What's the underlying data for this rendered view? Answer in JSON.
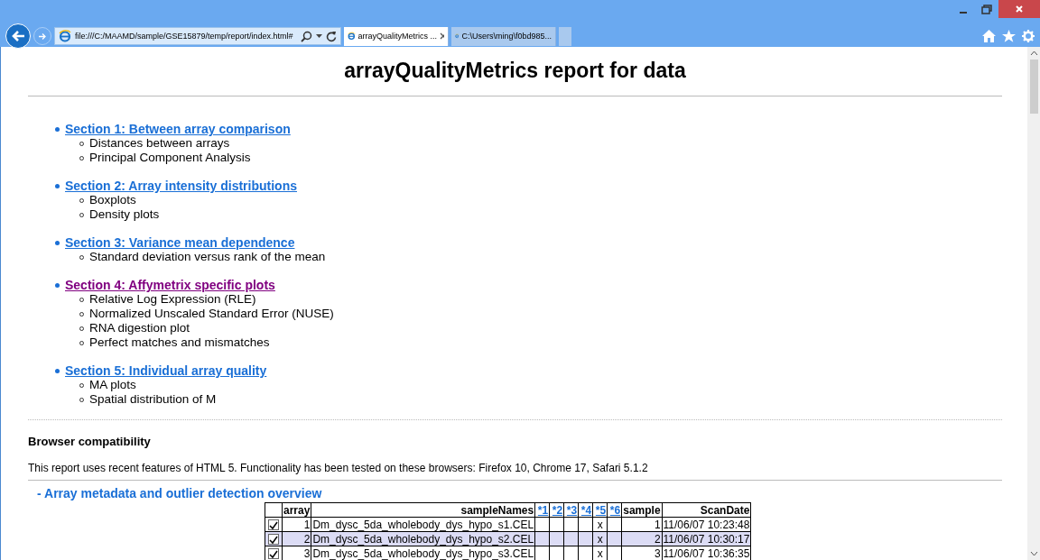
{
  "browser": {
    "address": "file:///C:/MAAMD/sample/GSE15879/temp/report/index.html#",
    "tabs": [
      {
        "label": "arrayQualityMetrics ...",
        "selected": true
      },
      {
        "label": "C:\\Users\\ming\\f0bd985...",
        "selected": false
      }
    ]
  },
  "page": {
    "title": "arrayQualityMetrics report for data",
    "sections": [
      {
        "label": "Section 1: Between array comparison",
        "visited": false,
        "items": [
          "Distances between arrays",
          "Principal Component Analysis"
        ]
      },
      {
        "label": "Section 2: Array intensity distributions",
        "visited": false,
        "items": [
          "Boxplots",
          "Density plots"
        ]
      },
      {
        "label": "Section 3: Variance mean dependence",
        "visited": false,
        "items": [
          "Standard deviation versus rank of the mean"
        ]
      },
      {
        "label": "Section 4: Affymetrix specific plots",
        "visited": true,
        "items": [
          "Relative Log Expression (RLE)",
          "Normalized Unscaled Standard Error (NUSE)",
          "RNA digestion plot",
          "Perfect matches and mismatches"
        ]
      },
      {
        "label": "Section 5: Individual array quality",
        "visited": false,
        "items": [
          "MA plots",
          "Spatial distribution of M"
        ]
      }
    ],
    "compat_heading": "Browser compatibility",
    "compat_text": "This report uses recent features of HTML 5. Functionality has been tested on these browsers: Firefox 10, Chrome 17, Safari 5.1.2",
    "overview_heading": "- Array metadata and outlier detection overview",
    "table": {
      "columns": [
        {
          "label": "array",
          "kind": "text"
        },
        {
          "label": "sampleNames",
          "kind": "text"
        },
        {
          "label": "*1",
          "kind": "link"
        },
        {
          "label": "*2",
          "kind": "link"
        },
        {
          "label": "*3",
          "kind": "link"
        },
        {
          "label": "*4",
          "kind": "link"
        },
        {
          "label": "*5",
          "kind": "link"
        },
        {
          "label": "*6",
          "kind": "link"
        },
        {
          "label": "sample",
          "kind": "text"
        },
        {
          "label": "ScanDate",
          "kind": "text"
        }
      ],
      "rows": [
        {
          "checked": true,
          "selected": false,
          "cells": [
            "1",
            "Dm_dysc_5da_wholebody_dys_hypo_s1.CEL",
            "",
            "",
            "",
            "",
            "x",
            "",
            "1",
            "11/06/07 10:23:48"
          ]
        },
        {
          "checked": true,
          "selected": true,
          "cells": [
            "2",
            "Dm_dysc_5da_wholebody_dys_hypo_s2.CEL",
            "",
            "",
            "",
            "",
            "x",
            "",
            "2",
            "11/06/07 10:30:17"
          ]
        },
        {
          "checked": true,
          "selected": false,
          "cells": [
            "3",
            "Dm_dysc_5da_wholebody_dys_hypo_s3.CEL",
            "",
            "",
            "",
            "",
            "x",
            "",
            "3",
            "11/06/07 10:36:35"
          ]
        }
      ]
    }
  }
}
